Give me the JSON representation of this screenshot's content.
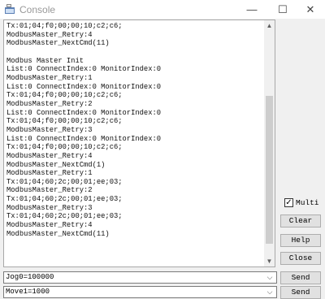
{
  "window": {
    "title": "Console",
    "minimize_glyph": "—",
    "maximize_glyph": "☐",
    "close_glyph": "✕"
  },
  "console": {
    "lines": [
      "Tx:01;04;f0;00;00;10;c2;c6;",
      "ModbusMaster_Retry:4",
      "ModbusMaster_NextCmd(11)",
      "",
      "Modbus Master Init",
      "List:0 ConnectIndex:0 MonitorIndex:0",
      "ModbusMaster_Retry:1",
      "List:0 ConnectIndex:0 MonitorIndex:0",
      "Tx:01;04;f0;00;00;10;c2;c6;",
      "ModbusMaster_Retry:2",
      "List:0 ConnectIndex:0 MonitorIndex:0",
      "Tx:01;04;f0;00;00;10;c2;c6;",
      "ModbusMaster_Retry:3",
      "List:0 ConnectIndex:0 MonitorIndex:0",
      "Tx:01;04;f0;00;00;10;c2;c6;",
      "ModbusMaster_Retry:4",
      "ModbusMaster_NextCmd(1)",
      "ModbusMaster_Retry:1",
      "Tx:01;04;60;2c;00;01;ee;03;",
      "ModbusMaster_Retry:2",
      "Tx:01;04;60;2c;00;01;ee;03;",
      "ModbusMaster_Retry:3",
      "Tx:01;04;60;2c;00;01;ee;03;",
      "ModbusMaster_Retry:4",
      "ModbusMaster_NextCmd(11)"
    ]
  },
  "controls": {
    "multi_label": "Multi",
    "multi_checked": true,
    "check_glyph": "✓",
    "clear_label": "Clear",
    "help_label": "Help",
    "close_label": "Close",
    "send_label": "Send"
  },
  "commands": {
    "cmd1_value": "Jog0=100000",
    "cmd2_value": "Move1=1000"
  },
  "icons": {
    "up_arrow": "▲",
    "down_arrow": "▼",
    "dropdown": "⌵"
  }
}
